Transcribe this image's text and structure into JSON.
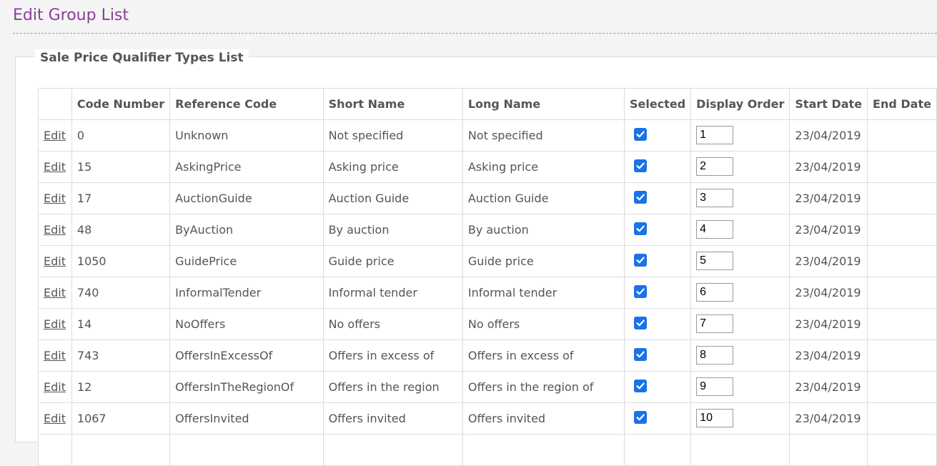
{
  "page": {
    "title": "Edit Group List"
  },
  "panel": {
    "legend": "Sale Price Qualifier Types List"
  },
  "table": {
    "headers": {
      "edit": "",
      "code_number": "Code Number",
      "reference_code": "Reference Code",
      "short_name": "Short Name",
      "long_name": "Long Name",
      "selected": "Selected",
      "display_order": "Display Order",
      "start_date": "Start Date",
      "end_date": "End Date"
    },
    "rows": [
      {
        "edit": "Edit",
        "code": "0",
        "ref": "Unknown",
        "short": "Not specified",
        "long": "Not specified",
        "selected": true,
        "order": "1",
        "start": "23/04/2019",
        "end": ""
      },
      {
        "edit": "Edit",
        "code": "15",
        "ref": "AskingPrice",
        "short": "Asking price",
        "long": "Asking price",
        "selected": true,
        "order": "2",
        "start": "23/04/2019",
        "end": ""
      },
      {
        "edit": "Edit",
        "code": "17",
        "ref": "AuctionGuide",
        "short": "Auction Guide",
        "long": "Auction Guide",
        "selected": true,
        "order": "3",
        "start": "23/04/2019",
        "end": ""
      },
      {
        "edit": "Edit",
        "code": "48",
        "ref": "ByAuction",
        "short": "By auction",
        "long": "By auction",
        "selected": true,
        "order": "4",
        "start": "23/04/2019",
        "end": ""
      },
      {
        "edit": "Edit",
        "code": "1050",
        "ref": "GuidePrice",
        "short": "Guide price",
        "long": "Guide price",
        "selected": true,
        "order": "5",
        "start": "23/04/2019",
        "end": ""
      },
      {
        "edit": "Edit",
        "code": "740",
        "ref": "InformalTender",
        "short": "Informal tender",
        "long": "Informal tender",
        "selected": true,
        "order": "6",
        "start": "23/04/2019",
        "end": ""
      },
      {
        "edit": "Edit",
        "code": "14",
        "ref": "NoOffers",
        "short": "No offers",
        "long": "No offers",
        "selected": true,
        "order": "7",
        "start": "23/04/2019",
        "end": ""
      },
      {
        "edit": "Edit",
        "code": "743",
        "ref": "OffersInExcessOf",
        "short": "Offers in excess of",
        "long": "Offers in excess of",
        "selected": true,
        "order": "8",
        "start": "23/04/2019",
        "end": ""
      },
      {
        "edit": "Edit",
        "code": "12",
        "ref": "OffersInTheRegionOf",
        "short": "Offers in the region",
        "long": "Offers in the region of",
        "selected": true,
        "order": "9",
        "start": "23/04/2019",
        "end": ""
      },
      {
        "edit": "Edit",
        "code": "1067",
        "ref": "OffersInvited",
        "short": "Offers invited",
        "long": "Offers invited",
        "selected": true,
        "order": "10",
        "start": "23/04/2019",
        "end": ""
      },
      {
        "edit": "",
        "code": "",
        "ref": "",
        "short": "",
        "long": "",
        "selected": false,
        "order": "",
        "start": "",
        "end": ""
      }
    ]
  },
  "colors": {
    "title": "#8a3f9b",
    "checkbox": "#1a73e8",
    "text": "#555555",
    "border": "#dcdcdc"
  },
  "icons": {
    "checkbox": "checkmark-icon"
  }
}
